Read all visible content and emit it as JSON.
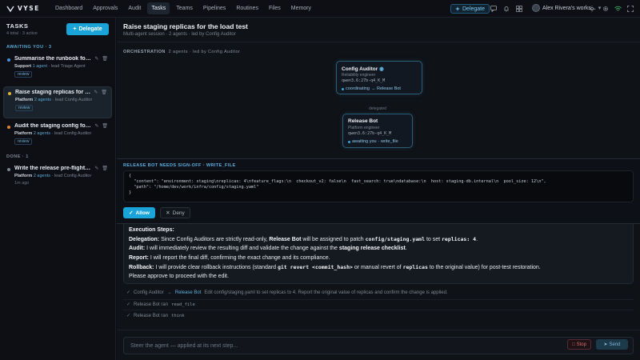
{
  "app": {
    "logo_text": "VYSE"
  },
  "nav": {
    "items": [
      {
        "label": "Dashboard"
      },
      {
        "label": "Approvals"
      },
      {
        "label": "Audit"
      },
      {
        "label": "Tasks",
        "active": true
      },
      {
        "label": "Teams"
      },
      {
        "label": "Pipelines"
      },
      {
        "label": "Routines"
      },
      {
        "label": "Files"
      },
      {
        "label": "Memory"
      }
    ],
    "delegate_label": "Delegate",
    "workspace_label": "Alex Rivera's works..."
  },
  "sidebar": {
    "title": "TASKS",
    "summary": "4 total · 3 active",
    "delegate_label": "Delegate",
    "awaiting_label": "AWAITING YOU · 3",
    "done_label": "DONE · 1",
    "tasks": [
      {
        "title": "Summarise the runbook for on-...",
        "team": "Support",
        "agents": "1 agent",
        "lead": "· lead Triage Agent",
        "chip": "review",
        "dot_color": "#4a8fe0"
      },
      {
        "title": "Raise staging replicas for the lo...",
        "team": "Platform",
        "agents": "2 agents",
        "lead": "· lead Config Auditor",
        "chip": "review",
        "dot_color": "#e0b23a"
      },
      {
        "title": "Audit the staging config for drift",
        "team": "Platform",
        "agents": "2 agents",
        "lead": "· lead Config Auditor",
        "chip": "review",
        "dot_color": "#e0852f"
      },
      {
        "title": "Write the release pre-flight che...",
        "team": "Platform",
        "agents": "2 agents",
        "lead": "· lead Config Auditor",
        "age": "1m ago",
        "dot_color": "#7d8794"
      }
    ]
  },
  "main": {
    "title": "Raise staging replicas for the load test",
    "subtitle": "Multi-agent session · 2 agents · led by Config Auditor",
    "orchestration_label": "ORCHESTRATION",
    "orchestration_meta": "2 agents · led by Config Auditor",
    "nodes": [
      {
        "name": "Config Auditor",
        "role": "Reliability engineer",
        "model": "qwen3.6:27b-q4_K_M",
        "status": "coordinating",
        "target": "→ Release Bot"
      },
      {
        "name": "Release Bot",
        "role": "Platform engineer",
        "model": "qwen3.6:27b-q4_K_M",
        "status": "awaiting you",
        "target": "· write_file"
      }
    ],
    "edge_label": "delegated"
  },
  "approval": {
    "heading": "RELEASE BOT NEEDS SIGN-OFF · WRITE_FILE",
    "code_lines": [
      "{",
      "  \"content\": \"environment: staging\\nreplicas: 4\\nfeature_flags:\\n  checkout_v2: false\\n  fast_search: true\\ndatabase:\\n  host: staging-db.internal\\n  pool_size: 12\\n\",",
      "  \"path\": \"/home/dev/work/infra/config/staging.yaml\"",
      "}"
    ],
    "allow_label": "Allow",
    "deny_label": "Deny"
  },
  "message": {
    "heading": "Execution Steps:",
    "delegation_label": "Delegation:",
    "delegation_a": "Since Config Auditors are strictly read-only,",
    "delegation_agent": "Release Bot",
    "delegation_b": "will be assigned to patch",
    "delegation_file": "config/staging.yaml",
    "delegation_c": "to set",
    "delegation_value": "replicas: 4",
    "delegation_end": ".",
    "audit_label": "Audit:",
    "audit_a": "I will immediately review the resulting diff and validate the change against the",
    "audit_bold": "staging release checklist",
    "audit_end": ".",
    "report_label": "Report:",
    "report_text": "I will report the final diff, confirming the exact change and its compliance.",
    "rollback_label": "Rollback:",
    "rollback_a": "I will provide clear rollback instructions (standard",
    "rollback_code": "git revert <commit_hash>",
    "rollback_b": "or manual revert of",
    "rollback_code2": "replicas",
    "rollback_c": "to the original value) for post-test restoration.",
    "closing": "Please approve to proceed with the edit."
  },
  "activity": [
    {
      "from": "Config Auditor",
      "arrow": "→",
      "to": "Release Bot",
      "text": "Edit config/staging.yaml to set replicas to 4. Report the original value of replicas and confirm the change is applied."
    },
    {
      "text": "Release Bot ran",
      "code": "read_file"
    },
    {
      "text": "Release Bot ran",
      "code": "think"
    }
  ],
  "composer": {
    "placeholder": "Steer the agent — applied at its next step...",
    "stop_label": "Stop",
    "send_label": "Send"
  }
}
